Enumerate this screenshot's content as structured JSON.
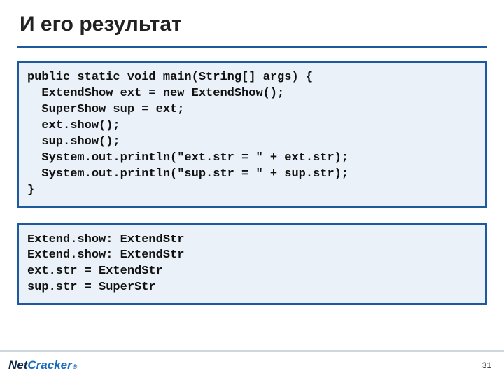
{
  "title": "И его результат",
  "code_block_1": "public static void main(String[] args) {\n  ExtendShow ext = new ExtendShow();\n  SuperShow sup = ext;\n  ext.show();\n  sup.show();\n  System.out.println(\"ext.str = \" + ext.str);\n  System.out.println(\"sup.str = \" + sup.str);\n}",
  "code_block_2": "Extend.show: ExtendStr\nExtend.show: ExtendStr\next.str = ExtendStr\nsup.str = SuperStr",
  "footer": {
    "logo_part1": "Net",
    "logo_part2": "Cracker",
    "logo_mark": "®",
    "page_number": "31"
  }
}
